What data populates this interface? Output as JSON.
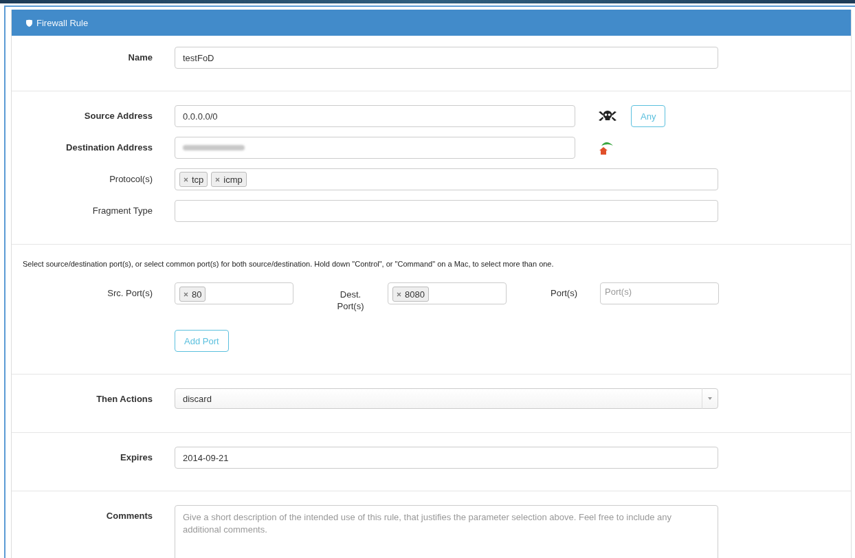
{
  "panel": {
    "title": "Firewall Rule"
  },
  "sections": [
    {
      "fields": [
        {
          "kind": "text",
          "label": "Name",
          "bold": true,
          "value": "testFoD"
        }
      ]
    },
    {
      "fields": [
        {
          "kind": "text",
          "label": "Source Address",
          "bold": true,
          "value": "0.0.0.0/0",
          "button": "Any"
        },
        {
          "kind": "redacted",
          "label": "Destination Address",
          "bold": true
        },
        {
          "kind": "tags",
          "label": "Protocol(s)",
          "bold": false,
          "tags": [
            "tcp",
            "icmp"
          ]
        },
        {
          "kind": "text",
          "label": "Fragment Type",
          "bold": false
        }
      ]
    },
    {
      "help": "Select source/destination port(s), or select common port(s) for both source/destination. Hold down \"Control\", or \"Command\" on a Mac, to select more than one.",
      "fields": [
        {
          "kind": "ports",
          "ports": [
            {
              "label": "Src. Port(s)",
              "tags": [
                "80"
              ]
            },
            {
              "label": "Dest. Port(s)",
              "tags": [
                "8080"
              ]
            },
            {
              "label": "Port(s)",
              "placeholder": "Port(s)"
            }
          ]
        },
        {
          "kind": "button",
          "label": "Add Port"
        }
      ]
    },
    {
      "fields": [
        {
          "kind": "select",
          "label": "Then Actions",
          "bold": true,
          "value": "discard"
        }
      ]
    },
    {
      "fields": [
        {
          "kind": "text",
          "label": "Expires",
          "bold": true,
          "value": "2014-09-21"
        }
      ]
    },
    {
      "fields": [
        {
          "kind": "textarea",
          "label": "Comments",
          "bold": true,
          "placeholder": "Give a short description of the intended use of this rule, that justifies the parameter selection above. Feel free to include any additional comments."
        }
      ]
    }
  ]
}
